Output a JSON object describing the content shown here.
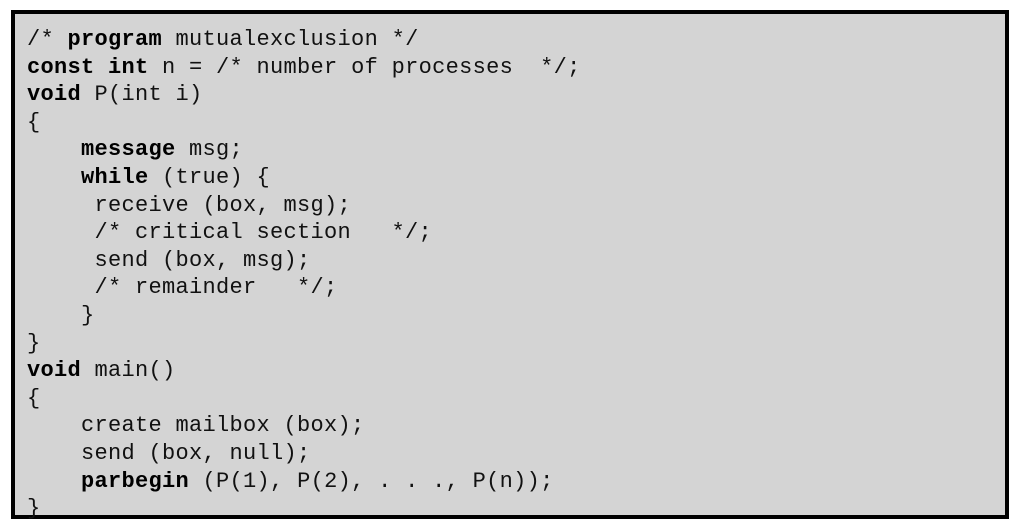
{
  "code_lines": [
    [
      {
        "t": "/* ",
        "b": false
      },
      {
        "t": "program",
        "b": true
      },
      {
        "t": " mutualexclusion */",
        "b": false
      }
    ],
    [
      {
        "t": "const int",
        "b": true
      },
      {
        "t": " n = /* number of processes  */;",
        "b": false
      }
    ],
    [
      {
        "t": "void",
        "b": true
      },
      {
        "t": " P(int i)",
        "b": false
      }
    ],
    [
      {
        "t": "{",
        "b": false
      }
    ],
    [
      {
        "t": "    ",
        "b": false
      },
      {
        "t": "message",
        "b": true
      },
      {
        "t": " msg;",
        "b": false
      }
    ],
    [
      {
        "t": "    ",
        "b": false
      },
      {
        "t": "while",
        "b": true
      },
      {
        "t": " (true) {",
        "b": false
      }
    ],
    [
      {
        "t": "     receive (box, msg);",
        "b": false
      }
    ],
    [
      {
        "t": "     /* critical section   */;",
        "b": false
      }
    ],
    [
      {
        "t": "     send (box, msg);",
        "b": false
      }
    ],
    [
      {
        "t": "     /* remainder   */;",
        "b": false
      }
    ],
    [
      {
        "t": "    }",
        "b": false
      }
    ],
    [
      {
        "t": "}",
        "b": false
      }
    ],
    [
      {
        "t": "void",
        "b": true
      },
      {
        "t": " main()",
        "b": false
      }
    ],
    [
      {
        "t": "{",
        "b": false
      }
    ],
    [
      {
        "t": "    create mailbox (box);",
        "b": false
      }
    ],
    [
      {
        "t": "    send (box, null);",
        "b": false
      }
    ],
    [
      {
        "t": "    ",
        "b": false
      },
      {
        "t": "parbegin",
        "b": true
      },
      {
        "t": " (P(1), P(2), . . ., P(n));",
        "b": false
      }
    ],
    [
      {
        "t": "}",
        "b": false
      }
    ]
  ]
}
